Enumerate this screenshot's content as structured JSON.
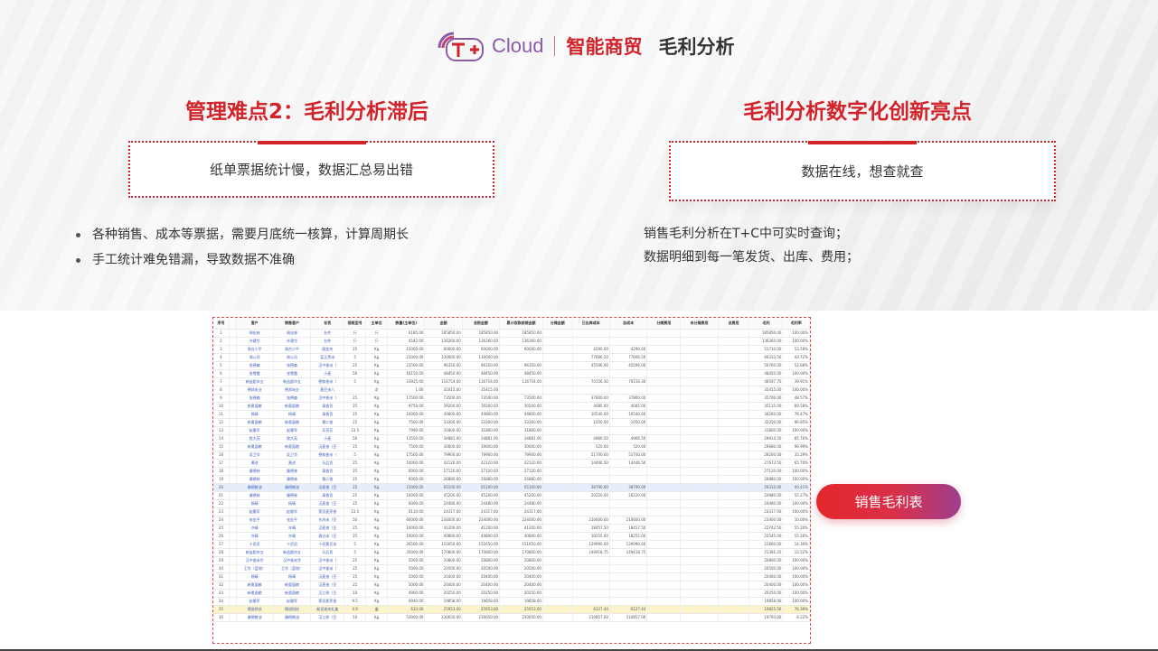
{
  "header": {
    "cloud": "Cloud",
    "brand": "智能商贸",
    "title": "毛利分析",
    "logo_icon": "tplus-logo-icon"
  },
  "left": {
    "title": "管理难点2：毛利分析滞后",
    "box_text": "纸单票据统计慢，数据汇总易出错",
    "bullets": [
      "各种销售、成本等票据，需要月底统一核算，计算周期长",
      "手工统计难免错漏，导致数据不准确"
    ]
  },
  "right": {
    "title": "毛利分析数字化创新亮点",
    "box_text": "数据在线，想查就查",
    "lines": [
      "销售毛利分析在T+C中可实时查询；",
      "数据明细到每一笔发货、出库、费用；"
    ]
  },
  "button": {
    "label": "销售毛利表"
  },
  "colors": {
    "accent": "#d2232a",
    "button_end": "#9d3f8f"
  },
  "sheet": {
    "headers": [
      "序号",
      "",
      "客户",
      "销售客户",
      "存货",
      "规格型号",
      "主单位",
      "数量(主单位)",
      "金额",
      "含税金额",
      "累计收款核销金额",
      "分摊金额",
      "已出库成本",
      "总成本",
      "分摊费用",
      "未分摊费用",
      "总费用",
      "毛利",
      "毛利率"
    ],
    "rows": [
      [
        "1",
        "",
        "周化林",
        "周化林",
        "台件",
        "斤",
        "斤",
        "6185.00",
        "185850.00",
        "185850.00",
        "185850.00",
        "",
        "",
        "",
        "",
        "",
        "",
        "185850.00",
        "100.00%"
      ],
      [
        "2",
        "",
        "许建华",
        "许建华",
        "台件",
        "斤",
        "斤",
        "4542.00",
        "136260.00",
        "136260.00",
        "136260.00",
        "",
        "",
        "",
        "",
        "",
        "",
        "136260.00",
        "100.00%"
      ],
      [
        "3",
        "",
        "周台小平",
        "周台小平",
        "厨卖充",
        "25",
        "Kg",
        "15000.00",
        "60000.00",
        "60000.00",
        "60000.00",
        "",
        "4290.00",
        "4290.00",
        "",
        "",
        "",
        "51710.00",
        "53.58%"
      ],
      [
        "4",
        "",
        "周公司",
        "周公司",
        "蓝正黑米",
        "5",
        "Kg",
        "21000.00",
        "130000.00",
        "130000.00",
        "",
        "",
        "77666.50",
        "77666.50",
        "",
        "",
        "",
        "60333.50",
        "43.72%"
      ],
      [
        "5",
        "",
        "张德森",
        "张德森",
        "汉中香米（",
        "25",
        "Kg",
        "23500.00",
        "96350.00",
        "96350.00",
        "96350.00",
        "",
        "45596.00",
        "45596.00",
        "",
        "",
        "",
        "50760.00",
        "52.68%"
      ],
      [
        "6",
        "",
        "张雪霞",
        "张雪霞",
        "小麦",
        "50",
        "Kg",
        "16150.00",
        "48450.00",
        "48450.00",
        "48450.00",
        "",
        "",
        "",
        "",
        "",
        "",
        "48450.00",
        "100.00%"
      ],
      [
        "7",
        "",
        "新益超市五",
        "新益超市五",
        "德和香米（",
        "5",
        "Kg",
        "23925.00",
        "116754.00",
        "116754.00",
        "116754.00",
        "",
        "70156.30",
        "70156.30",
        "",
        "",
        "",
        "46597.70",
        "39.91%"
      ],
      [
        "8",
        "",
        "德邦米业",
        "德邦米业",
        "黄豆米八",
        "",
        "次",
        "1.00",
        "35415.00",
        "35415.00",
        "",
        "",
        "",
        "",
        "",
        "",
        "",
        "35415.00",
        "100.00%"
      ],
      [
        "9",
        "",
        "张德森",
        "张德森",
        "汉中香米（",
        "25",
        "Kg",
        "17500.00",
        "73500.00",
        "73500.00",
        "73500.00",
        "",
        "37800.00",
        "37800.00",
        "",
        "",
        "",
        "35700.00",
        "48.57%"
      ],
      [
        "10",
        "",
        "新奥面粮",
        "新奥面粮",
        "清香贡",
        "25",
        "Kg",
        "9750.00",
        "39200.00",
        "39200.00",
        "39200.00",
        "",
        "4085.00",
        "4085.00",
        "",
        "",
        "",
        "35115.00",
        "89.58%"
      ],
      [
        "11",
        "",
        "杨晴",
        "杨晴",
        "清香贡",
        "25",
        "Kg",
        "10000.00",
        "44800.00",
        "44800.00",
        "44800.00",
        "",
        "10540.00",
        "10540.00",
        "",
        "",
        "",
        "34260.00",
        "76.47%"
      ],
      [
        "12",
        "",
        "新奥面粮",
        "新奥面粮",
        "黄二香",
        "25",
        "Kg",
        "7560.00",
        "33300.00",
        "33300.00",
        "33300.00",
        "",
        "1050.00",
        "1050.00",
        "",
        "",
        "",
        "32250.00",
        "96.85%"
      ],
      [
        "13",
        "",
        "赵雅军",
        "赵雅军",
        "芳贡芳",
        "23.5",
        "Kg",
        "7990.00",
        "31800.00",
        "31800.00",
        "31800.00",
        "",
        "",
        "",
        "",
        "",
        "",
        "31800.00",
        "100.00%"
      ],
      [
        "14",
        "",
        "牧大苑",
        "牧大苑",
        "小麦",
        "50",
        "Kg",
        "11550.00",
        "34881.00",
        "34881.00",
        "34881.00",
        "",
        "4966.50",
        "4966.50",
        "",
        "",
        "",
        "29914.50",
        "85.76%"
      ],
      [
        "15",
        "",
        "新奥面粮",
        "新奥面粮",
        "汉麦香（豆",
        "25",
        "Kg",
        "7500.00",
        "30600.00",
        "30600.00",
        "30600.00",
        "",
        "520.00",
        "520.00",
        "",
        "",
        "",
        "29680.00",
        "96.99%"
      ],
      [
        "16",
        "",
        "吴卫华",
        "吴卫华",
        "德和香米（",
        "5",
        "Kg",
        "17500.00",
        "79900.00",
        "79900.00",
        "79900.00",
        "",
        "51700.00",
        "51700.00",
        "",
        "",
        "",
        "28200.00",
        "35.29%"
      ],
      [
        "17",
        "",
        "黄进",
        "黄进",
        "乐品贡",
        "25",
        "Kg",
        "10000.00",
        "42120.00",
        "42120.00",
        "42120.00",
        "",
        "14446.50",
        "14446.50",
        "",
        "",
        "",
        "27673.50",
        "65.70%"
      ],
      [
        "18",
        "",
        "康德林",
        "康德林",
        "清香贡",
        "25",
        "Kg",
        "6000.00",
        "27120.00",
        "27120.00",
        "27120.00",
        "",
        "",
        "",
        "",
        "",
        "",
        "27120.00",
        "100.00%"
      ],
      [
        "19",
        "",
        "康德林",
        "康德林",
        "黄二香",
        "25",
        "Kg",
        "6000.00",
        "26880.00",
        "26880.00",
        "26880.00",
        "",
        "",
        "",
        "",
        "",
        "",
        "26880.00",
        "100.00%"
      ],
      [
        "20",
        "",
        "康德粮油",
        "康德粮油",
        "汉麦香（豆",
        "25",
        "Kg",
        "15000.00",
        "65100.00",
        "65100.00",
        "65100.00",
        "",
        "38790.00",
        "38790.00",
        "",
        "",
        "",
        "26310.00",
        "40.41%"
      ],
      [
        "21",
        "",
        "康德林",
        "康德林",
        "清香贡",
        "25",
        "Kg",
        "10000.00",
        "45200.00",
        "45200.00",
        "45200.00",
        "",
        "20220.00",
        "20220.00",
        "",
        "",
        "",
        "24980.00",
        "55.27%"
      ],
      [
        "22",
        "",
        "杨晴",
        "杨晴",
        "汉麦香（豆",
        "25",
        "Kg",
        "6000.00",
        "24480.00",
        "24480.00",
        "24480.00",
        "",
        "",
        "",
        "",
        "",
        "",
        "24480.00",
        "100.00%"
      ],
      [
        "23",
        "",
        "赵雅军",
        "赵雅军",
        "荣贡麦芽香",
        "23.5",
        "Kg",
        "6110.00",
        "24317.00",
        "24317.00",
        "24317.00",
        "",
        "",
        "",
        "",
        "",
        "",
        "24317.00",
        "100.00%"
      ],
      [
        "24",
        "",
        "张金平",
        "张金平",
        "东苏米（豆",
        "50",
        "Kg",
        "60000.00",
        "234000.00",
        "234000.00",
        "234000.00",
        "",
        "210600.00",
        "210600.00",
        "",
        "",
        "",
        "23400.00",
        "10.00%"
      ],
      [
        "25",
        "",
        "许晴",
        "许晴",
        "汉麦香（豆",
        "25",
        "Kg",
        "10000.00",
        "41200.00",
        "41200.00",
        "41200.00",
        "",
        "18457.50",
        "18457.50",
        "",
        "",
        "",
        "22742.50",
        "55.20%"
      ],
      [
        "26",
        "",
        "许晴",
        "许晴",
        "清谷米（豆",
        "25",
        "Kg",
        "10000.00",
        "40800.00",
        "40800.00",
        "40800.00",
        "",
        "18255.00",
        "18255.00",
        "",
        "",
        "",
        "22545.00",
        "55.26%"
      ],
      [
        "27",
        "",
        "十佰贡",
        "十佰贡",
        "十佰黄豆米",
        "5",
        "Kg",
        "26500.00",
        "151650.00",
        "151650.00",
        "151650.00",
        "",
        "129990.00",
        "129990.00",
        "",
        "",
        "",
        "21660.00",
        "14.30%"
      ],
      [
        "28",
        "",
        "新益超市五",
        "新益超市五",
        "乐品贡",
        "5",
        "Kg",
        "35000.00",
        "170800.00",
        "170800.00",
        "170800.00",
        "",
        "149418.75",
        "149418.75",
        "",
        "",
        "",
        "21381.25",
        "12.52%"
      ],
      [
        "29",
        "",
        "汉中香米华",
        "汉中香米华",
        "汉中香米（",
        "25",
        "Kg",
        "5000.00",
        "20800.00",
        "20800.00",
        "20800.00",
        "",
        "",
        "",
        "",
        "",
        "",
        "20800.00",
        "100.00%"
      ],
      [
        "30",
        "",
        "王华（蓝地）",
        "王华（蓝地）",
        "汉中香米（",
        "25",
        "Kg",
        "5000.00",
        "20500.00",
        "20500.00",
        "20500.00",
        "",
        "",
        "",
        "",
        "",
        "",
        "20500.00",
        "100.00%"
      ],
      [
        "31",
        "",
        "杨晴",
        "杨晴",
        "汉麦香（豆",
        "25",
        "Kg",
        "5000.00",
        "20400.00",
        "20400.00",
        "20400.00",
        "",
        "",
        "",
        "",
        "",
        "",
        "20400.00",
        "100.00%"
      ],
      [
        "32",
        "",
        "新奥面粮",
        "新奥面粮",
        "汉麦香（豆",
        "25",
        "Kg",
        "5000.00",
        "20400.00",
        "20400.00",
        "20400.00",
        "",
        "",
        "",
        "",
        "",
        "",
        "20400.00",
        "100.00%"
      ],
      [
        "33",
        "",
        "新奥面粮",
        "新奥面粮",
        "汉江原（豆",
        "10",
        "Kg",
        "4900.00",
        "20250.00",
        "20250.00",
        "20250.00",
        "",
        "",
        "",
        "",
        "",
        "",
        "20250.00",
        "100.00%"
      ],
      [
        "34",
        "",
        "赵雅军",
        "赵雅军",
        "荣贡麦芽香",
        "9.5",
        "Kg",
        "4940.00",
        "19858.00",
        "19858.00",
        "19858.00",
        "",
        "",
        "",
        "",
        "",
        "",
        "19858.00",
        "100.00%"
      ],
      [
        "35",
        "",
        "德进科技",
        "德进科技",
        "新贡香米礼盒",
        "4.9",
        "盒",
        "633.00",
        "25953.00",
        "25953.00",
        "25953.00",
        "",
        "6127.44",
        "6127.44",
        "",
        "",
        "",
        "19825.56",
        "76.39%"
      ],
      [
        "36",
        "",
        "康德粮油",
        "康德粮油",
        "汉江原（豆",
        "10",
        "Kg",
        "53900.00",
        "230650.00",
        "230650.00",
        "230650.00",
        "",
        "210857.00",
        "210857.00",
        "",
        "",
        "",
        "19793.00",
        "8.22%"
      ]
    ]
  }
}
